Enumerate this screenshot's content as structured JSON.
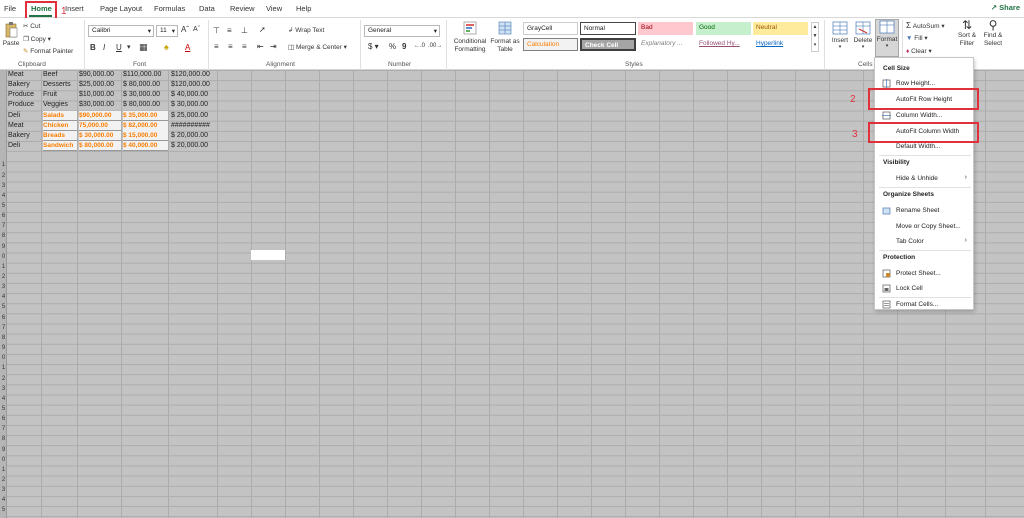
{
  "tabs": [
    "File",
    "Home",
    "Insert",
    "Page Layout",
    "Formulas",
    "Data",
    "Review",
    "View",
    "Help"
  ],
  "share_label": "Share",
  "clipboard": {
    "paste": "Paste",
    "cut": "Cut",
    "copy": "Copy",
    "format_painter": "Format Painter",
    "group": "Clipboard"
  },
  "font": {
    "name": "Calibri",
    "size": "11",
    "group": "Font"
  },
  "alignment": {
    "wrap": "Wrap Text",
    "merge": "Merge & Center",
    "group": "Alignment"
  },
  "number": {
    "format": "General",
    "group": "Number"
  },
  "styles": {
    "conditional": "Conditional Formatting",
    "format_table": "Format as Table",
    "group": "Styles",
    "cells": [
      "GrayCell",
      "Normal",
      "Bad",
      "Good",
      "Neutral",
      "Calculation",
      "Check Cell",
      "Explanatory ...",
      "Followed Hy...",
      "Hyperlink"
    ]
  },
  "cells_group": {
    "insert": "Insert",
    "delete": "Delete",
    "format": "Format",
    "group": "Cells"
  },
  "editing": {
    "autosum": "AutoSum",
    "fill": "Fill",
    "clear": "Clear",
    "sort": "Sort & Filter",
    "find": "Find & Select"
  },
  "rows": [
    [
      "Meat",
      "Beef",
      "$90,000.00",
      "$110,000.00",
      "$120,000.00"
    ],
    [
      "Bakery",
      "Desserts",
      "$25,000.00",
      "$ 80,000.00",
      "$120,000.00"
    ],
    [
      "Produce",
      "Fruit",
      "$10,000.00",
      "$ 30,000.00",
      "$ 40,000.00"
    ],
    [
      "Produce",
      "Veggies",
      "$30,000.00",
      "$ 80,000.00",
      "$ 30,000.00"
    ],
    [
      "Deli",
      "Salads",
      "$90,000.00",
      "$ 35,000.00",
      "$ 25,000.00"
    ],
    [
      "Meat",
      "Chicken",
      "75,000.00",
      "$ 82,000.00",
      "##########"
    ],
    [
      "Bakery",
      "Breads",
      "$ 30,000.00",
      "$ 15,000.00",
      "$ 20,000.00"
    ],
    [
      "Deli",
      "Sandwich",
      "$ 80,000.00",
      "$ 40,000.00",
      "$ 20,000.00"
    ]
  ],
  "row_numbers": [
    "",
    "",
    "",
    "",
    "",
    "",
    "",
    "",
    "",
    "1",
    "2",
    "3",
    "4",
    "5",
    "6",
    "7",
    "8",
    "9",
    "0",
    "1",
    "2",
    "3",
    "4",
    "5",
    "6",
    "7",
    "8",
    "9",
    "0",
    "1",
    "2",
    "3",
    "4",
    "5",
    "6",
    "7",
    "8",
    "9",
    "0",
    "1",
    "2",
    "3",
    "4",
    "5"
  ],
  "menu": {
    "cell_size": "Cell Size",
    "row_height": "Row Height...",
    "autofit_row": "AutoFit Row Height",
    "column_width": "Column Width...",
    "autofit_column": "AutoFit Column Width",
    "default_width": "Default Width...",
    "visibility": "Visibility",
    "hide_unhide": "Hide & Unhide",
    "organize": "Organize Sheets",
    "rename": "Rename Sheet",
    "move_copy": "Move or Copy Sheet...",
    "tab_color": "Tab Color",
    "protection": "Protection",
    "protect": "Protect Sheet...",
    "lock": "Lock Cell",
    "format_cells": "Format Cells..."
  },
  "annotations": [
    "1",
    "2",
    "3"
  ],
  "colors": {
    "accent": "#217346",
    "highlight": "#e0303b"
  }
}
